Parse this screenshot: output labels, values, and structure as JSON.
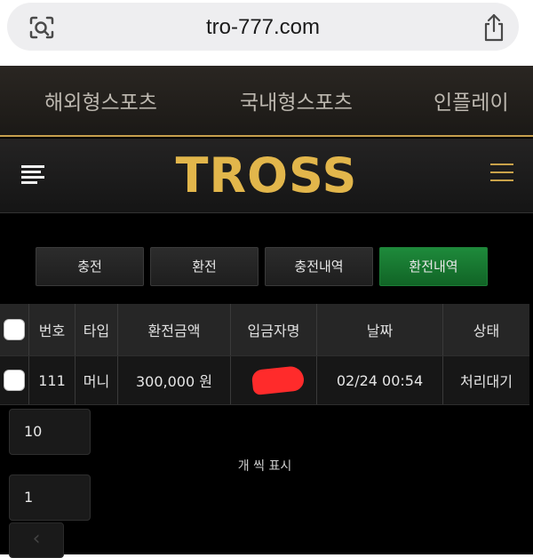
{
  "browser": {
    "url": "tro-777.com",
    "left_icon": "visual-search-icon",
    "right_icon": "share-icon"
  },
  "top_nav": {
    "items": [
      "해외형스포츠",
      "국내형스포츠",
      "인플레이"
    ]
  },
  "header": {
    "logo": "TROSS",
    "left_icon": "menu-icon",
    "right_icon": "hamburger-icon",
    "logo_color": "#e2b64b"
  },
  "tabs": [
    {
      "label": "충전",
      "active": false
    },
    {
      "label": "환전",
      "active": false
    },
    {
      "label": "충전내역",
      "active": false
    },
    {
      "label": "환전내역",
      "active": true
    }
  ],
  "table": {
    "headers": [
      "번호",
      "타입",
      "환전금액",
      "입금자명",
      "날짜",
      "상태"
    ],
    "rows": [
      {
        "no": "111",
        "type": "머니",
        "amount": "300,000 원",
        "depositor": "",
        "date": "02/24 00:54",
        "status": "처리대기"
      }
    ]
  },
  "pagination": {
    "per_page_value": "10",
    "per_page_label": "개 씩 표시",
    "page_value": "1",
    "prev_icon": "chevron-left-icon"
  },
  "colors": {
    "accent_gold": "#c7a04d",
    "active_tab_green": "#1e8a3b"
  }
}
